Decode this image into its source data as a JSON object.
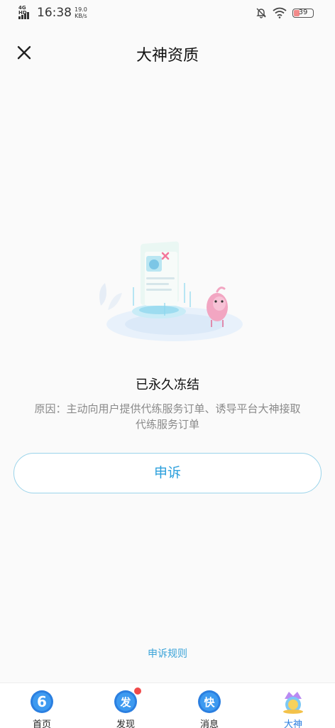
{
  "status_bar": {
    "network": "4G HD",
    "time": "16:38",
    "speed_value": "19.0",
    "speed_unit": "KB/s",
    "battery": "39"
  },
  "header": {
    "title": "大神资质"
  },
  "main": {
    "status_title": "已永久冻结",
    "reason": "原因：主动向用户提供代练服务订单、诱导平台大神接取代练服务订单",
    "appeal_button": "申诉",
    "rules_link": "申诉规则"
  },
  "tabs": [
    {
      "label": "首页",
      "icon": "home-six-icon",
      "icon_text": "6",
      "active": false
    },
    {
      "label": "发现",
      "icon": "discover-icon",
      "icon_text": "发",
      "active": false,
      "badge": true
    },
    {
      "label": "消息",
      "icon": "message-icon",
      "icon_text": "快",
      "active": false
    },
    {
      "label": "大神",
      "icon": "master-icon",
      "active": true
    }
  ],
  "colors": {
    "accent": "#2b9fdc",
    "active_tab": "#2b7fe0",
    "badge": "#f04a4a",
    "button_border": "#9bd4ea"
  }
}
